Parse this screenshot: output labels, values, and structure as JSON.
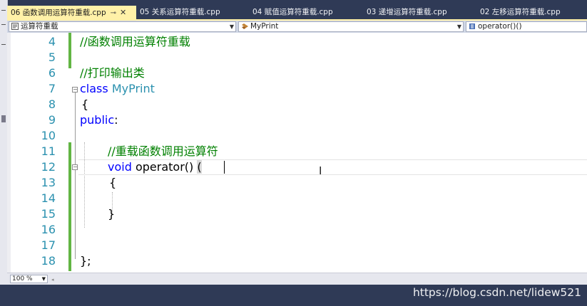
{
  "tabs": [
    {
      "label": "06 函数调用运算符重载.cpp",
      "active": true
    },
    {
      "label": "05 关系运算符重载.cpp"
    },
    {
      "label": "04 赋值运算符重载.cpp"
    },
    {
      "label": "03 递增运算符重载.cpp"
    },
    {
      "label": "02 左移运算符重载.cpp"
    }
  ],
  "tab_pin_icon": "pin-icon",
  "tab_close_icon": "close-icon",
  "navbar": {
    "scope": "运算符重载",
    "class": "MyPrint",
    "member": "operator()()"
  },
  "lines": [
    {
      "num": "4",
      "comment": "//函数调用运算符重载"
    },
    {
      "num": "5"
    },
    {
      "num": "6",
      "comment": "//打印输出类"
    },
    {
      "num": "7",
      "kw": "class",
      "type": "MyPrint"
    },
    {
      "num": "8",
      "text": "{"
    },
    {
      "num": "9",
      "kw": "public",
      "text": ":"
    },
    {
      "num": "10"
    },
    {
      "num": "11",
      "comment": "//重载函数调用运算符"
    },
    {
      "num": "12",
      "kw": "void",
      "text": "operator()",
      "paren": "("
    },
    {
      "num": "13",
      "text": "{"
    },
    {
      "num": "14"
    },
    {
      "num": "15",
      "text": "}"
    },
    {
      "num": "16"
    },
    {
      "num": "17"
    },
    {
      "num": "18",
      "text": "};"
    }
  ],
  "status": {
    "zoom": "100 %"
  },
  "watermark": "https://blog.csdn.net/lidew521",
  "colors": {
    "comment": "#008000",
    "keyword": "#0000ff",
    "type": "#2b91af",
    "line_number": "#2b91af",
    "active_tab": "#fff1a8",
    "chrome": "#2f3a56"
  }
}
